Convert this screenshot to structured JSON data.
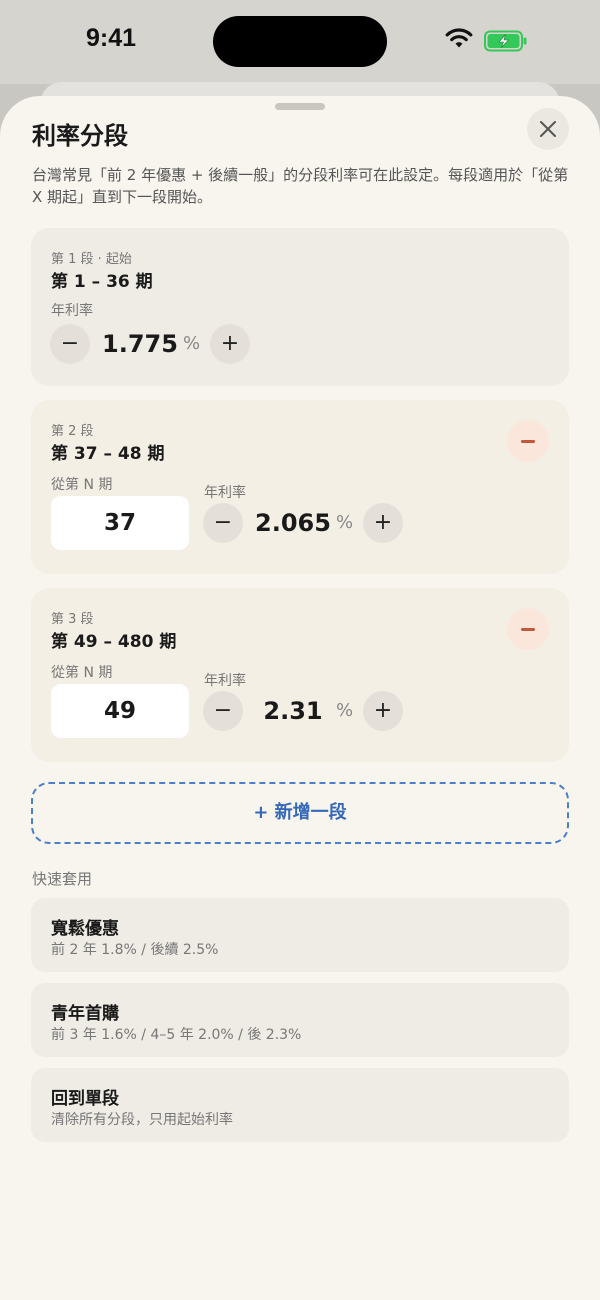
{
  "status_bar": {
    "time": "9:41"
  },
  "sheet": {
    "title": "利率分段",
    "description": "台灣常見「前 2 年優惠 + 後續一般」的分段利率可在此設定。每段適用於「從第 X 期起」直到下一段開始。"
  },
  "segments": [
    {
      "label": "第 1 段 · 起始",
      "range": "第 1 – 36 期",
      "rate_label": "年利率",
      "rate": "1.775",
      "unit": "%"
    },
    {
      "label": "第 2 段",
      "range": "第 37 – 48 期",
      "start_label": "從第 N 期",
      "start": "37",
      "rate_label": "年利率",
      "rate": "2.065",
      "unit": "%"
    },
    {
      "label": "第 3 段",
      "range": "第 49 – 480 期",
      "start_label": "從第 N 期",
      "start": "49",
      "rate_label": "年利率",
      "rate": "2.31",
      "unit": "%"
    }
  ],
  "stepper": {
    "minus": "−",
    "plus": "+"
  },
  "add_segment_label": "+ 新增一段",
  "quick_apply": {
    "label": "快速套用",
    "presets": [
      {
        "title": "寬鬆優惠",
        "desc": "前 2 年 1.8% / 後續 2.5%"
      },
      {
        "title": "青年首購",
        "desc": "前 3 年 1.6% / 4–5 年 2.0% / 後 2.3%"
      },
      {
        "title": "回到單段",
        "desc": "清除所有分段，只用起始利率"
      }
    ]
  },
  "colors": {
    "accent": "#3569b8",
    "remove": "#c2583a",
    "battery": "#34c759"
  },
  "icons": [
    "wifi-icon",
    "battery-icon",
    "close-icon",
    "minus-icon",
    "plus-icon"
  ]
}
